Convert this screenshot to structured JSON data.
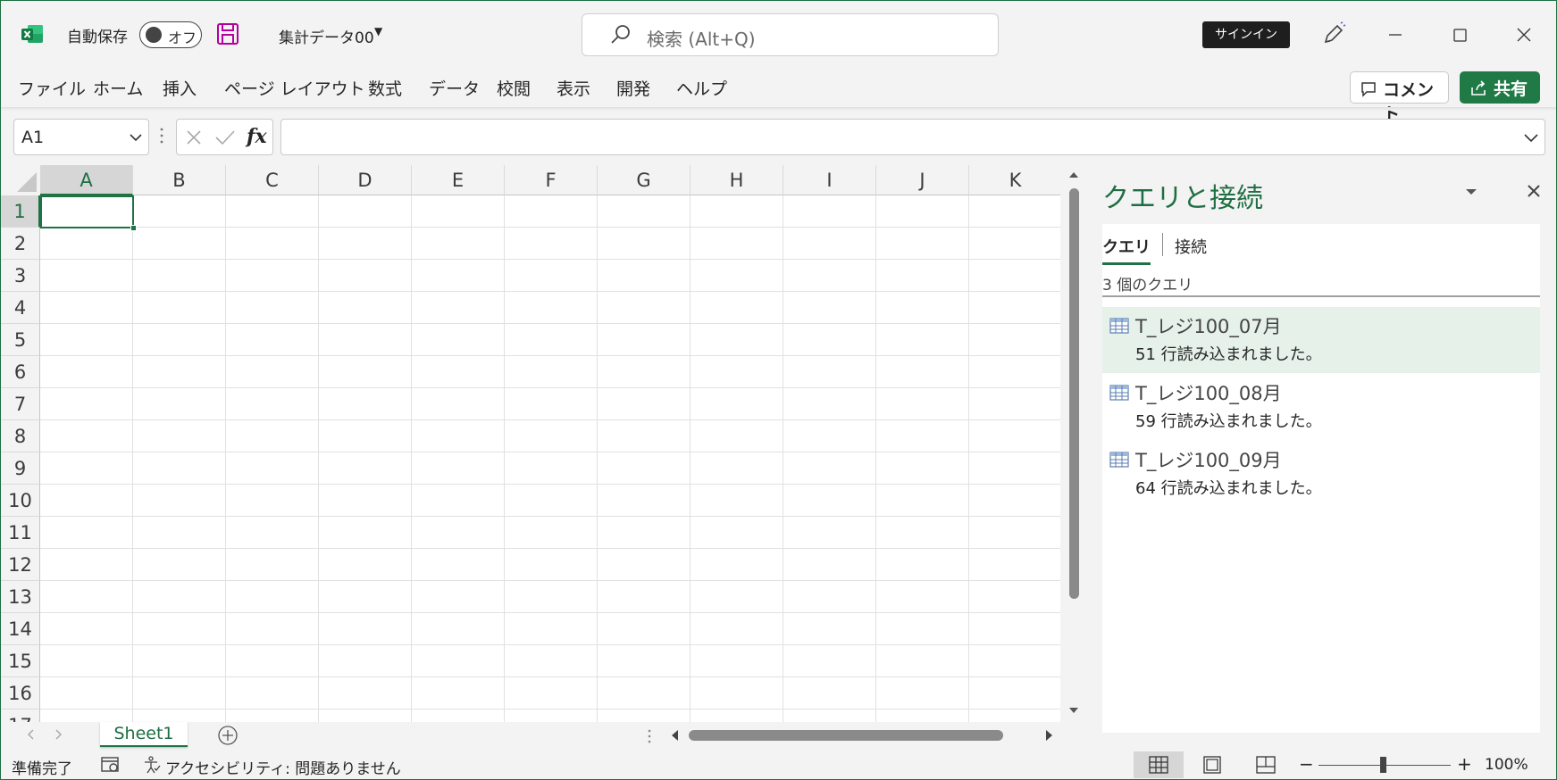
{
  "titlebar": {
    "autosave_label": "自動保存",
    "autosave_state": "オフ",
    "filename": "集計データ00",
    "search_placeholder": "検索 (Alt+Q)",
    "signin_label": "サインイン"
  },
  "ribbon": {
    "tabs": [
      "ファイル",
      "ホーム",
      "挿入",
      "ページ レイアウト",
      "数式",
      "データ",
      "校閲",
      "表示",
      "開発",
      "ヘルプ"
    ],
    "comment_label": "コメント",
    "share_label": "共有"
  },
  "formula_bar": {
    "name_box": "A1",
    "fx_label": "fx",
    "formula": ""
  },
  "grid": {
    "columns": [
      "A",
      "B",
      "C",
      "D",
      "E",
      "F",
      "G",
      "H",
      "I",
      "J",
      "K"
    ],
    "rows": [
      "1",
      "2",
      "3",
      "4",
      "5",
      "6",
      "7",
      "8",
      "9",
      "10",
      "11",
      "12",
      "13",
      "14",
      "15",
      "16",
      "17"
    ],
    "selected_cell": "A1"
  },
  "sheets": {
    "tabs": [
      "Sheet1"
    ]
  },
  "pane": {
    "title": "クエリと接続",
    "tab_queries": "クエリ",
    "tab_connections": "接続",
    "query_count": "3 個のクエリ",
    "queries": [
      {
        "name": "T_レジ100_07月",
        "rows": "51 行読み込まれました。"
      },
      {
        "name": "T_レジ100_08月",
        "rows": "59 行読み込まれました。"
      },
      {
        "name": "T_レジ100_09月",
        "rows": "64 行読み込まれました。"
      }
    ]
  },
  "status": {
    "ready": "準備完了",
    "accessibility": "アクセシビリティ: 問題ありません",
    "zoom": "100%"
  },
  "colors": {
    "accent": "#1f7244",
    "pane_title": "#1f6e43",
    "share_button": "#1f7a45",
    "selected_query_bg": "#e6f1ea"
  },
  "icons": [
    "excel-logo-icon",
    "save-icon",
    "search-icon",
    "pen-icon",
    "minimize-icon",
    "maximize-icon",
    "close-icon",
    "comment-icon",
    "share-icon",
    "cancel-icon",
    "enter-icon",
    "table-icon",
    "macro-icon",
    "accessibility-icon",
    "normal-view-icon",
    "page-layout-icon",
    "page-break-icon"
  ]
}
